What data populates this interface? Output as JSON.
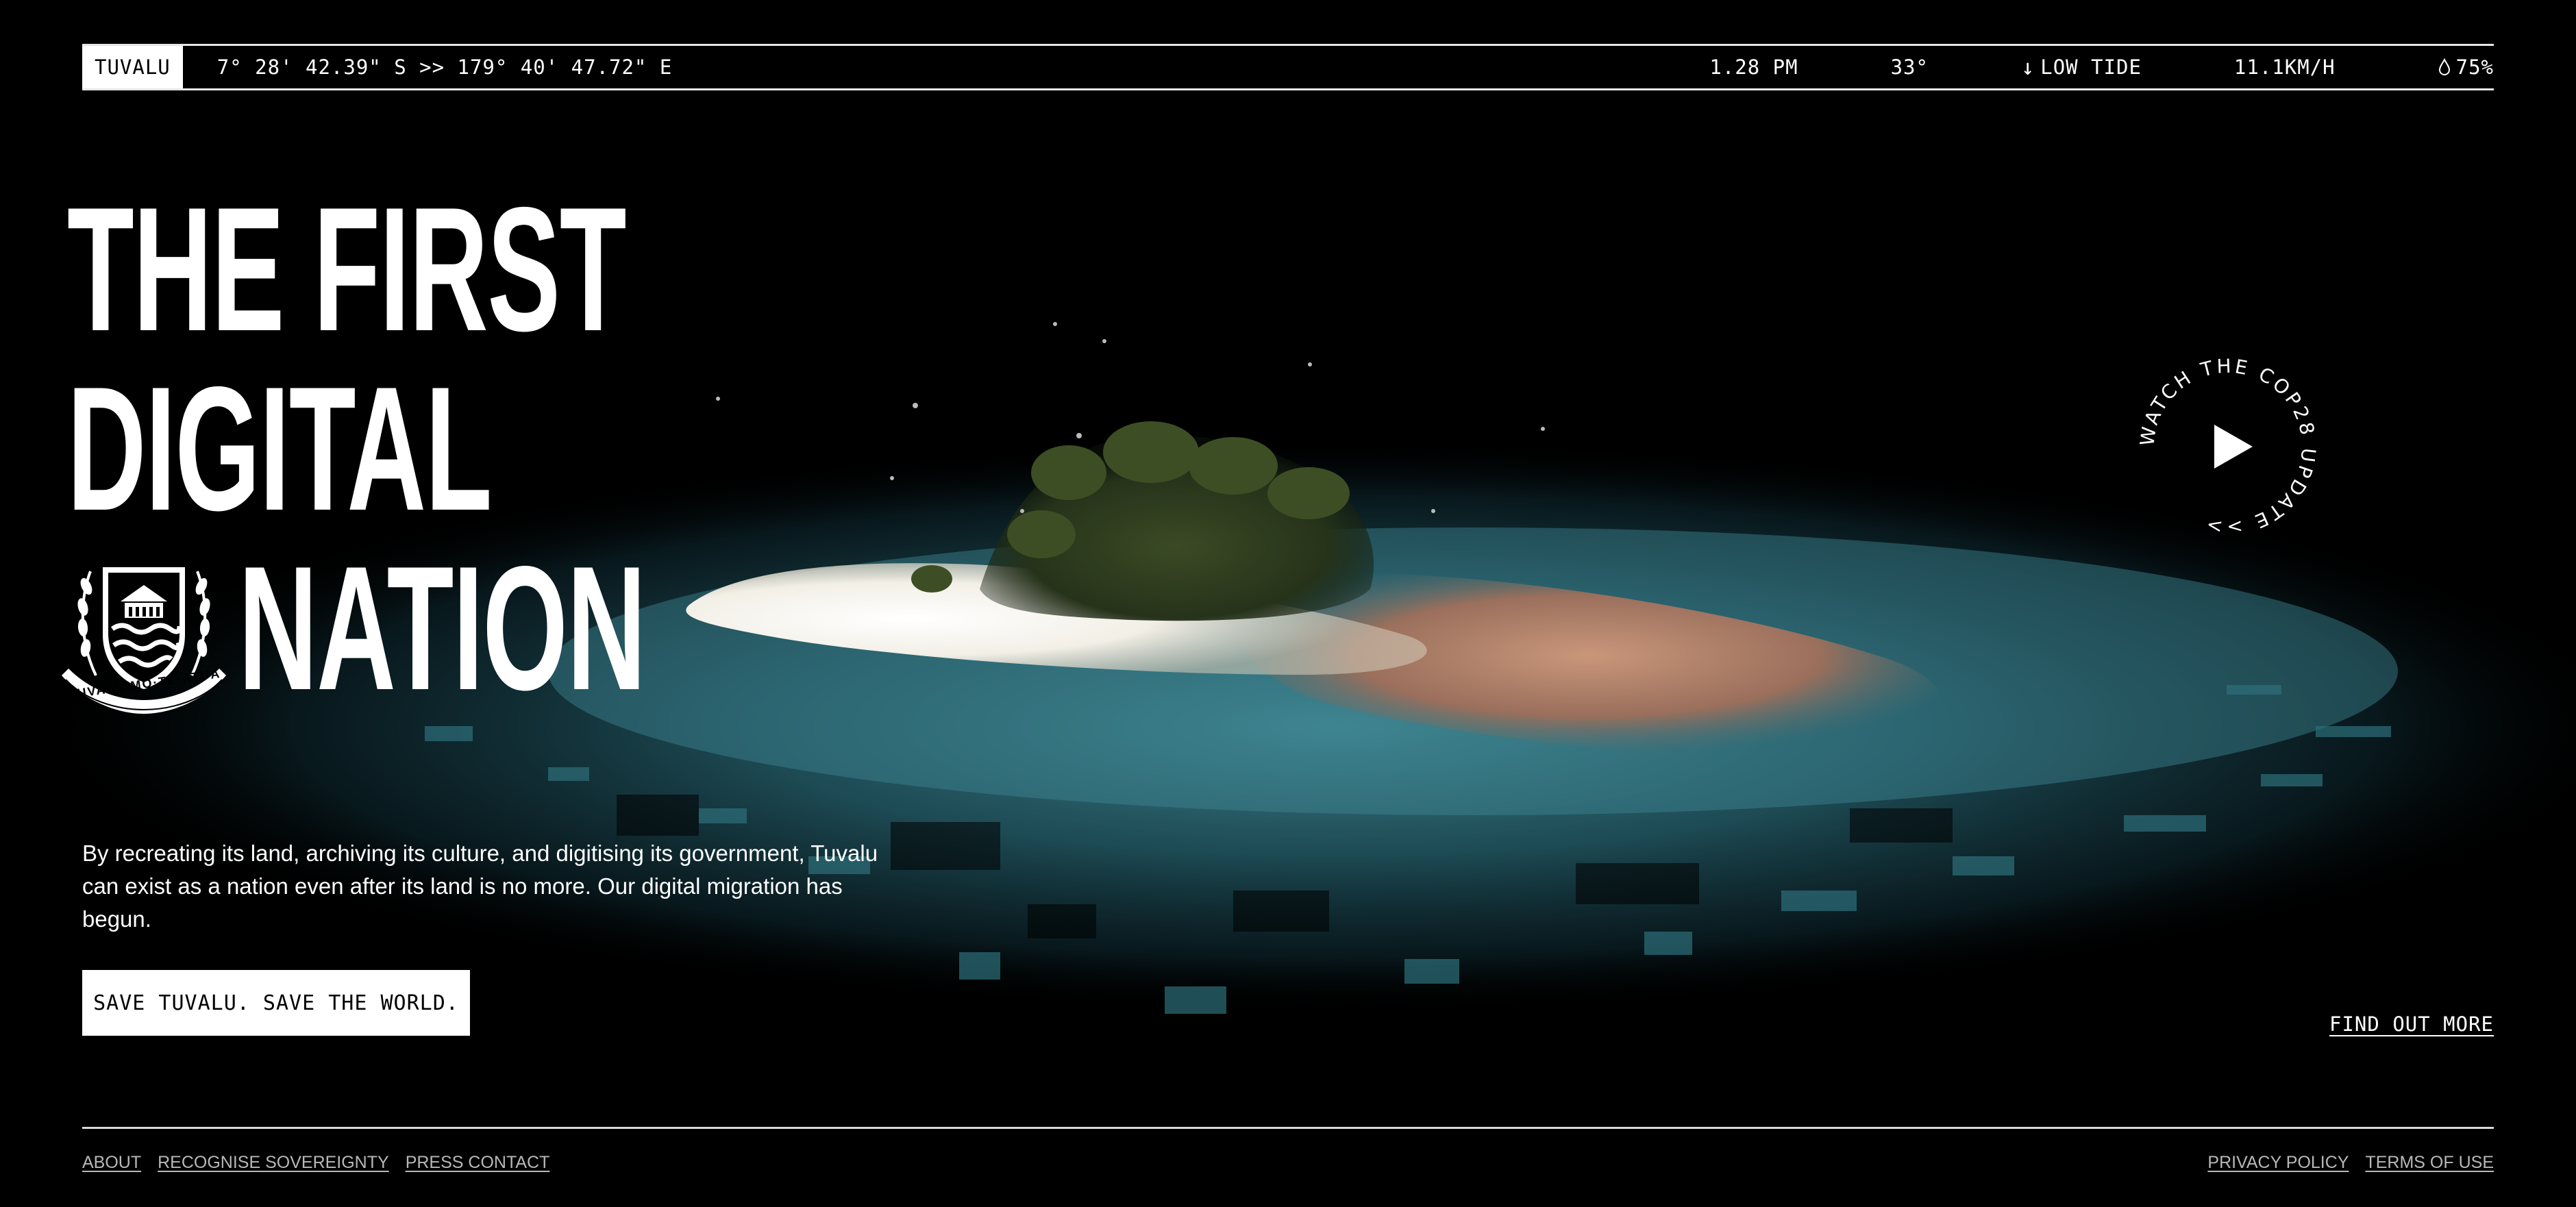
{
  "status_bar": {
    "country": "TUVALU",
    "coordinates": "7° 28' 42.39\" S >> 179° 40' 47.72\" E",
    "time": "1.28 PM",
    "temperature": "33°",
    "tide": "LOW TIDE",
    "tide_icon": "down-arrow-icon",
    "wind": "11.1KM/H",
    "humidity": "75%",
    "humidity_icon": "water-drop-icon"
  },
  "headline": {
    "line1": "THE FIRST",
    "line2": "DIGITAL",
    "line3": "NATION"
  },
  "emblem": {
    "icon": "tuvalu-coat-of-arms",
    "motto": "TUVALU·MO·TE·ATUA"
  },
  "intro_text": "By recreating its land, archiving its culture, and digitising its government, Tuvalu can exist as a nation even after its land is no more. Our digital migration has begun.",
  "cta_label": "SAVE TUVALU. SAVE THE WORLD.",
  "find_more_label": "FIND OUT MORE",
  "video_badge": {
    "text": "WATCH THE COP28 UPDATE >>",
    "icon": "play-icon"
  },
  "footer": {
    "left_links": [
      "ABOUT",
      "RECOGNISE SOVEREIGNTY",
      "PRESS CONTACT"
    ],
    "right_links": [
      "PRIVACY POLICY",
      "TERMS OF USE"
    ]
  },
  "colors": {
    "background": "#000000",
    "text": "#ffffff",
    "water": "#2f6f7c",
    "sand": "#f4f1e8",
    "reef": "#b98a6e"
  }
}
